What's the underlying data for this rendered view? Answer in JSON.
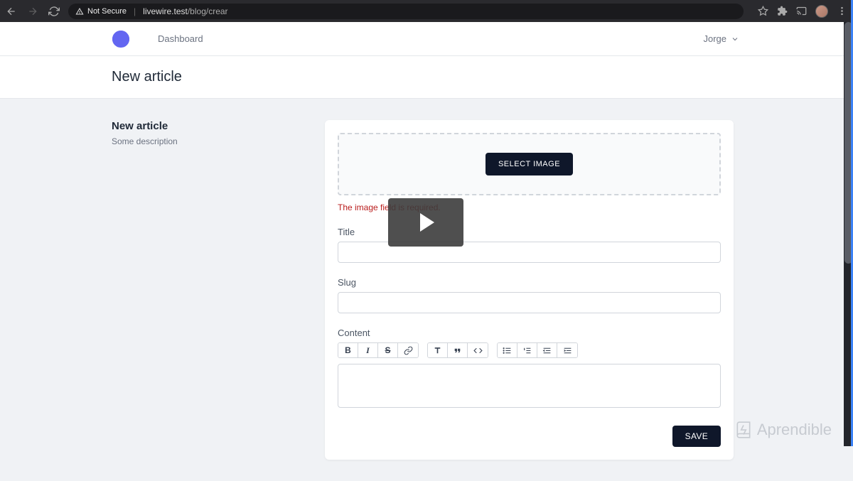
{
  "browser": {
    "security_label": "Not Secure",
    "url_host": "livewire.test",
    "url_path": "/blog/crear"
  },
  "nav": {
    "dashboard": "Dashboard",
    "user": "Jorge"
  },
  "page": {
    "title": "New article"
  },
  "section": {
    "heading": "New article",
    "description": "Some description"
  },
  "form": {
    "select_image": "SELECT IMAGE",
    "image_error": "The image field is required.",
    "title_label": "Title",
    "title_value": "",
    "slug_label": "Slug",
    "slug_value": "",
    "content_label": "Content",
    "content_value": "",
    "save": "SAVE"
  },
  "watermark": {
    "text": "Aprendible"
  }
}
